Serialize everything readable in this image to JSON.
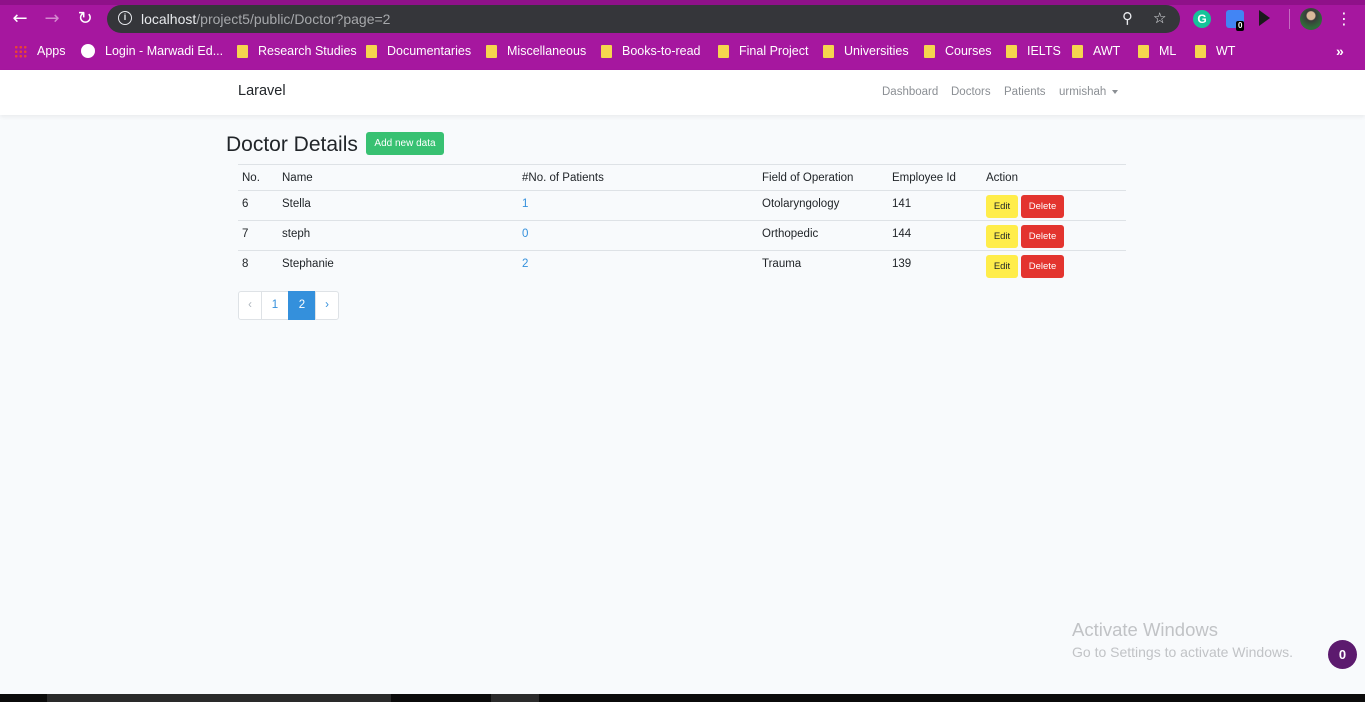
{
  "browser": {
    "url_host": "localhost",
    "url_path": "/project5/public/Doctor?page=2",
    "extension_badge": "0",
    "bookmarks": [
      {
        "label": "Apps",
        "icon": "apps-grid-icon"
      },
      {
        "label": "Login - Marwadi Ed...",
        "icon": "globe-icon"
      },
      {
        "label": "Research Studies",
        "icon": "folder-icon"
      },
      {
        "label": "Documentaries",
        "icon": "folder-icon"
      },
      {
        "label": "Miscellaneous",
        "icon": "folder-icon"
      },
      {
        "label": "Books-to-read",
        "icon": "folder-icon"
      },
      {
        "label": "Final Project",
        "icon": "folder-icon"
      },
      {
        "label": "Universities",
        "icon": "folder-icon"
      },
      {
        "label": "Courses",
        "icon": "folder-icon"
      },
      {
        "label": "IELTS",
        "icon": "folder-icon"
      },
      {
        "label": "AWT",
        "icon": "folder-icon"
      },
      {
        "label": "ML",
        "icon": "folder-icon"
      },
      {
        "label": "WT",
        "icon": "folder-icon"
      }
    ],
    "more_bookmarks": "»",
    "theme_color": "#a6179f"
  },
  "navbar": {
    "brand": "Laravel",
    "links": [
      "Dashboard",
      "Doctors",
      "Patients"
    ],
    "user": "urmishah"
  },
  "page": {
    "title": "Doctor Details",
    "add_button": "Add new data"
  },
  "table": {
    "headers": [
      "No.",
      "Name",
      "#No. of Patients",
      "Field of Operation",
      "Employee Id",
      "Action"
    ],
    "rows": [
      {
        "no": "6",
        "name": "Stella",
        "patients": "1",
        "field": "Otolaryngology",
        "emp_id": "141"
      },
      {
        "no": "7",
        "name": "steph",
        "patients": "0",
        "field": "Orthopedic",
        "emp_id": "144"
      },
      {
        "no": "8",
        "name": "Stephanie",
        "patients": "2",
        "field": "Trauma",
        "emp_id": "139"
      }
    ],
    "edit_label": "Edit",
    "delete_label": "Delete"
  },
  "pagination": {
    "prev": "‹",
    "pages": [
      "1",
      "2"
    ],
    "active": "2",
    "next": "›"
  },
  "watermark": {
    "line1": "Activate Windows",
    "line2": "Go to Settings to activate Windows."
  },
  "floating_badge": "0",
  "colors": {
    "success": "#38c172",
    "warning": "#ffed4a",
    "danger": "#e3342f",
    "primary": "#3490dc"
  }
}
